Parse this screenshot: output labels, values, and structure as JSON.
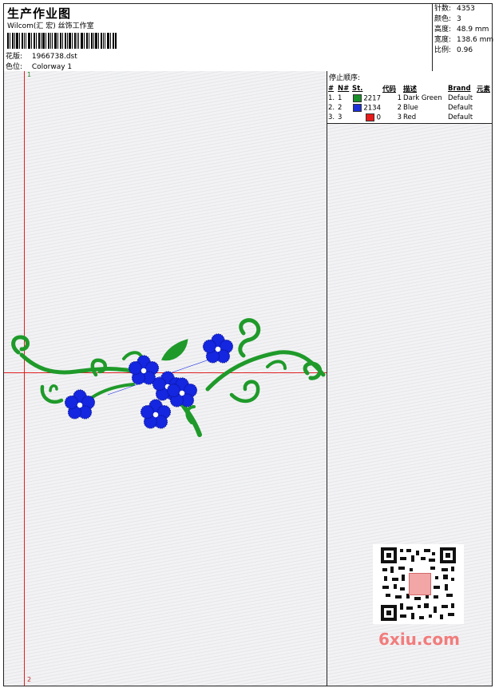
{
  "header": {
    "title": "生产作业图",
    "company": "Wilcom(汇 宏) 丝饰工作室",
    "design_label": "花版:",
    "design_value": "1966738.dst",
    "colorway_label": "色位:",
    "colorway_value": "Colorway 1"
  },
  "stats": [
    {
      "label": "针数:",
      "value": "4353"
    },
    {
      "label": "颜色:",
      "value": "3"
    },
    {
      "label": "高度:",
      "value": "48.9 mm"
    },
    {
      "label": "宽度:",
      "value": "138.6 mm"
    },
    {
      "label": "比例:",
      "value": "0.96"
    }
  ],
  "canvas": {
    "top_marker": "1",
    "bottom_marker": "2"
  },
  "stop_sequence": {
    "title": "停止顺序:",
    "columns": [
      "#",
      "N#",
      "St.",
      "代码",
      "描述",
      "Brand",
      "元素"
    ],
    "rows": [
      {
        "num": "1.",
        "n": "1",
        "color": "#1a8f2a",
        "st": "2217",
        "code": "1",
        "desc": "Dark Green",
        "brand": "Default"
      },
      {
        "num": "2.",
        "n": "2",
        "color": "#1a2fd8",
        "st": "2134",
        "code": "2",
        "desc": "Blue",
        "brand": "Default"
      },
      {
        "num": "3.",
        "n": "3",
        "color": "#e81b1b",
        "st": "0",
        "code": "3",
        "desc": "Red",
        "brand": "Default"
      }
    ]
  },
  "colors": {
    "green": "#1f9a2a",
    "blue": "#1426e0",
    "guide_red": "#e02020"
  },
  "watermark": {
    "brand": "6xiu.com"
  }
}
